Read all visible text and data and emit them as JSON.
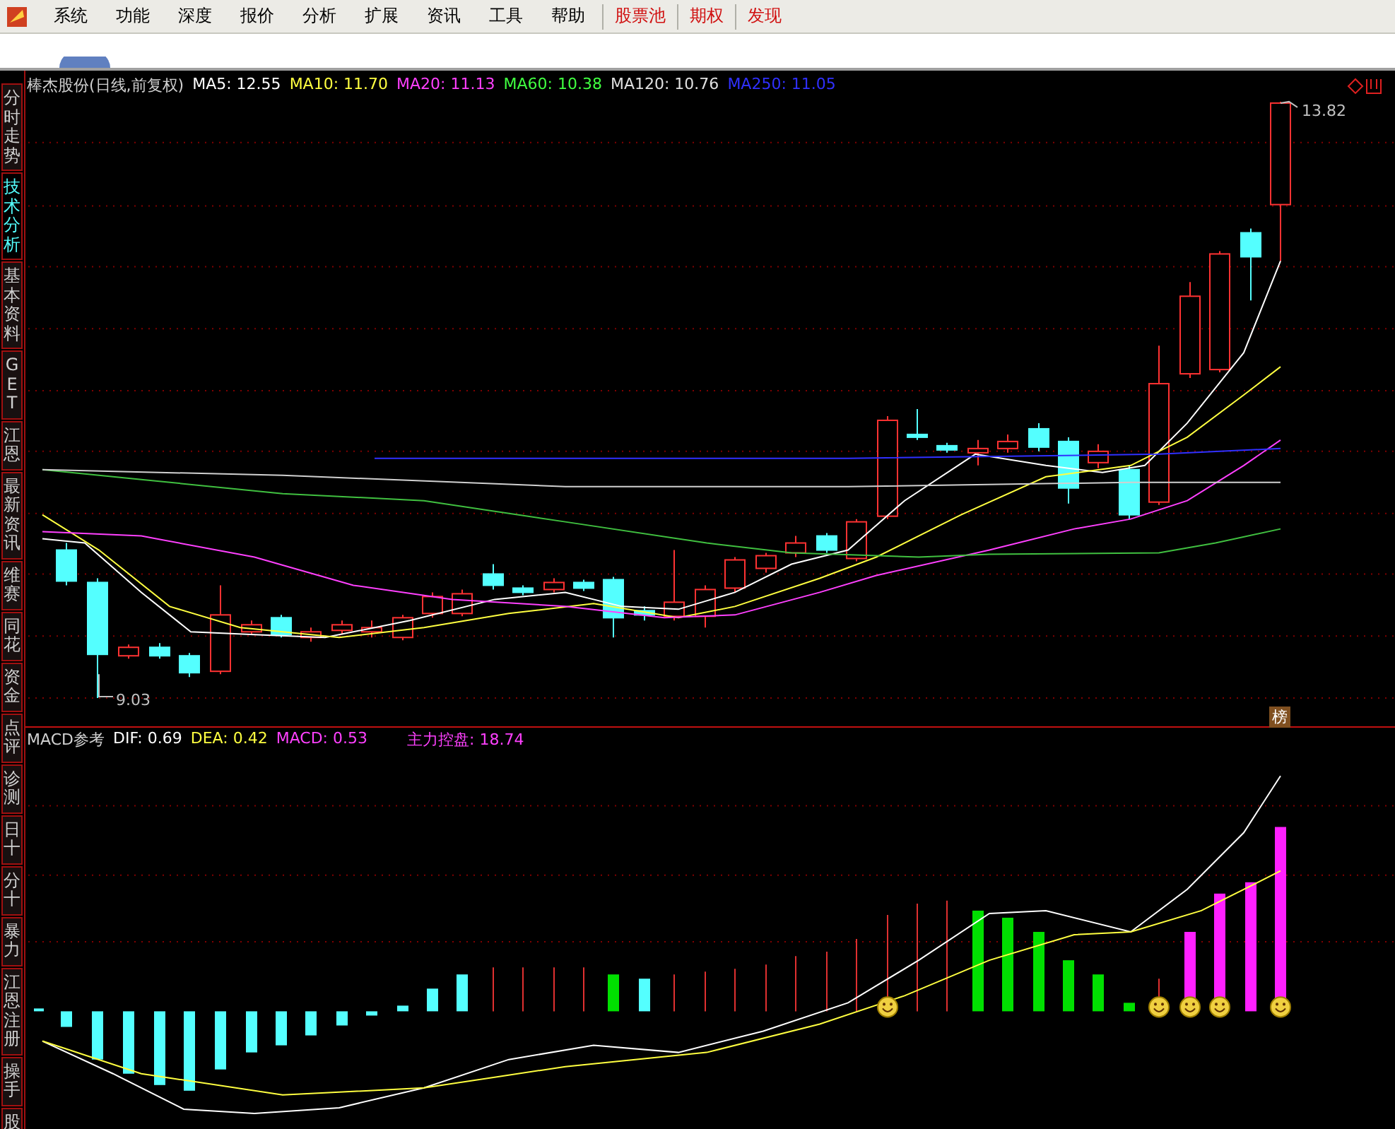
{
  "menu": [
    {
      "label": "系统",
      "kind": "menu"
    },
    {
      "label": "功能",
      "kind": "menu"
    },
    {
      "label": "深度",
      "kind": "menu"
    },
    {
      "label": "报价",
      "kind": "menu"
    },
    {
      "label": "分析",
      "kind": "menu"
    },
    {
      "label": "扩展",
      "kind": "menu"
    },
    {
      "label": "资讯",
      "kind": "menu"
    },
    {
      "label": "工具",
      "kind": "menu"
    },
    {
      "label": "帮助",
      "kind": "menu"
    },
    {
      "label": "股票池",
      "kind": "button"
    },
    {
      "label": "期权",
      "kind": "button"
    },
    {
      "label": "发现",
      "kind": "button"
    }
  ],
  "sidebar": {
    "tabs": [
      {
        "label": "分时走势",
        "selected": false
      },
      {
        "label": "技术分析",
        "selected": true
      },
      {
        "label": "基本资料",
        "selected": false
      },
      {
        "label": "GET",
        "selected": false
      },
      {
        "label": "江恩",
        "selected": false
      },
      {
        "label": "最新资讯",
        "selected": false
      },
      {
        "label": "维赛",
        "selected": false
      },
      {
        "label": "同花",
        "selected": false
      },
      {
        "label": "资金",
        "selected": false
      },
      {
        "label": "点评",
        "selected": false
      },
      {
        "label": "诊测",
        "selected": false
      },
      {
        "label": "日十",
        "selected": false
      },
      {
        "label": "分十",
        "selected": false
      },
      {
        "label": "暴力",
        "selected": false
      },
      {
        "label": "江恩注册",
        "selected": false
      },
      {
        "label": "操手",
        "selected": false
      },
      {
        "label": "股",
        "selected": false
      }
    ]
  },
  "main_chart": {
    "title": "棒杰股份(日线,前复权)",
    "indicators": [
      {
        "label": "MA5: 12.55",
        "color": "#ffffff"
      },
      {
        "label": "MA10: 11.70",
        "color": "#ffff40"
      },
      {
        "label": "MA20: 11.13",
        "color": "#ff40ff"
      },
      {
        "label": "MA60: 10.38",
        "color": "#40ff40"
      },
      {
        "label": "MA120: 10.76",
        "color": "#e0e0e0"
      },
      {
        "label": "MA250: 11.05",
        "color": "#3030ff"
      }
    ],
    "high_label": "13.82",
    "low_label": "9.03",
    "badge": "榜"
  },
  "macd_panel": {
    "title": "MACD参考",
    "indicators": [
      {
        "label": "DIF: 0.69",
        "color": "#ffffff"
      },
      {
        "label": "DEA: 0.42",
        "color": "#ffff40"
      },
      {
        "label": "MACD: 0.53",
        "color": "#ff40ff"
      },
      {
        "label": "主力控盘: 18.74",
        "color": "#ff40ff"
      }
    ]
  }
}
